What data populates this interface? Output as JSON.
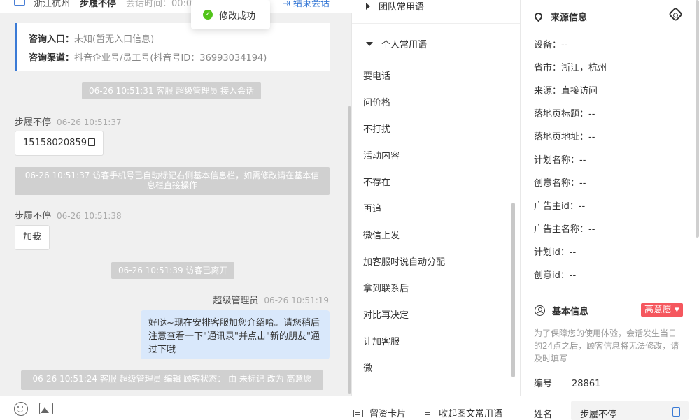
{
  "header": {
    "location": "浙江杭州",
    "visitor_name": "步履不停",
    "session_time_label": "会话时间：00:0",
    "end_session": "结束会话"
  },
  "toast": {
    "text": "修改成功"
  },
  "info_card": {
    "entry_label": "咨询入口：",
    "entry_value": "未知(暂无入口信息)",
    "channel_label": "咨询渠道：",
    "channel_value": "抖音企业号/员工号(抖音号ID：36993034194)"
  },
  "messages": {
    "sys1": "06-26 10:51:31 客服 超级管理员 接入会话",
    "sender1": "步履不停",
    "time1": "06-26 10:51:37",
    "bubble1": "15158020859",
    "sys2": "06-26 10:51:37 访客手机号已自动标记右侧基本信息栏，如需修改请在基本信息栏直接操作",
    "sender2": "步履不停",
    "time2": "06-26 10:51:38",
    "bubble2": "加我",
    "sys3": "06-26 10:51:39 访客已离开",
    "agent_name": "超级管理员",
    "agent_time": "06-26 10:51:19",
    "agent_msg": "好哒~现在安排客服加您介绍哈。请您稍后注意查看一下\"通讯录\"并点击\"新的朋友\"通过下哦",
    "sys4": "06-26 10:51:24 客服 超级管理员 编辑 顾客状态： 由 未标记 改为 高意愿"
  },
  "phrases": {
    "team_group": "团队常用语",
    "personal_group": "个人常用语",
    "items": [
      "要电话",
      "问价格",
      "不打扰",
      "活动内容",
      "不存在",
      "再追",
      "微信上发",
      "加客服时说自动分配",
      "拿到联系后",
      "对比再决定",
      "让加客服",
      "微"
    ]
  },
  "footer": {
    "card_btn": "留资卡片",
    "collapse_btn": "收起图文常用语"
  },
  "source_info": {
    "title": "来源信息",
    "fields": [
      "设备：--",
      "省市：浙江，杭州",
      "来源：直接访问",
      "落地页标题：--",
      "落地页地址：--",
      "计划名称：--",
      "创意名称：--",
      "广告主id：--",
      "广告主名称：--",
      "计划id：--",
      "创意id：--"
    ]
  },
  "basic_info": {
    "title": "基本信息",
    "intent_badge": "高意愿 ▾",
    "notice": "为了保障您的使用体验，会话发生当日的24点之后，顾客信息将无法修改，请及时填写",
    "id_label": "编号",
    "id_value": "28861",
    "name_label": "姓名",
    "name_value": "步履不停"
  },
  "colors": {
    "accent": "#3b7bd6",
    "success": "#52c41a",
    "badge": "#f5575e",
    "agent_bubble": "#d9e8fb"
  }
}
